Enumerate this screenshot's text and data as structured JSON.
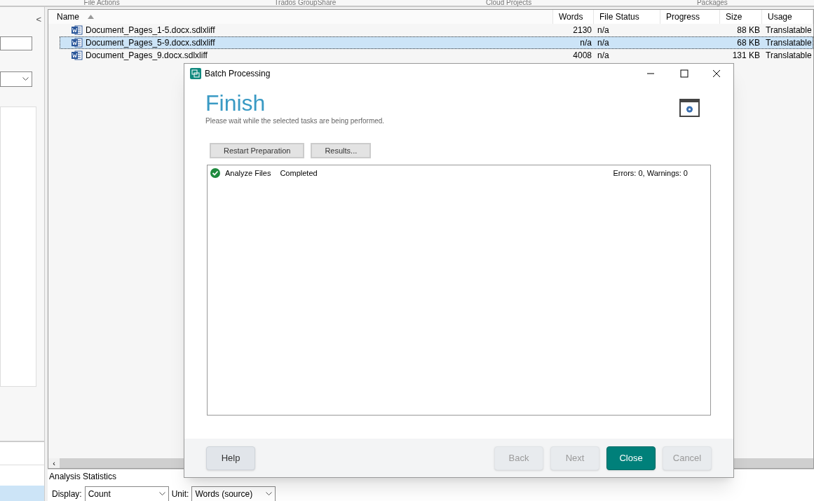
{
  "ribbon_groups": [
    "File Actions",
    "Trados GroupShare",
    "Cloud Projects",
    "Packages"
  ],
  "left_panel": {
    "collapse": "<"
  },
  "table": {
    "scroll_left": "‹",
    "columns": [
      {
        "label": "Name",
        "sorted": true
      },
      {
        "label": "Words",
        "sorted": false
      },
      {
        "label": "File Status",
        "sorted": false
      },
      {
        "label": "Progress",
        "sorted": false
      },
      {
        "label": "Size",
        "sorted": false
      },
      {
        "label": "Usage",
        "sorted": false
      }
    ],
    "rows": [
      {
        "name": "Document_Pages_1-5.docx.sdlxliff",
        "words": "2130",
        "file_status": "n/a",
        "size": "88 KB",
        "usage": "Translatable",
        "selected": false
      },
      {
        "name": "Document_Pages_5-9.docx.sdlxliff",
        "words": "n/a",
        "file_status": "n/a",
        "size": "68 KB",
        "usage": "Translatable",
        "selected": true
      },
      {
        "name": "Document_Pages_9.docx.sdlxliff",
        "words": "4008",
        "file_status": "n/a",
        "size": "131 KB",
        "usage": "Translatable",
        "selected": false
      }
    ]
  },
  "analysis": {
    "title": "Analysis Statistics",
    "display_label": "Display:",
    "display_value": "Count",
    "unit_label": "Unit:",
    "unit_value": "Words (source)"
  },
  "dialog": {
    "title": "Batch Processing",
    "heading": "Finish",
    "subtitle": "Please wait while the selected tasks are being performed.",
    "actions": [
      "Restart Preparation",
      "Results..."
    ],
    "tasks": [
      {
        "name": "Analyze Files",
        "status": "Completed",
        "summary": "Errors: 0, Warnings: 0",
        "done": true
      }
    ],
    "buttons": [
      {
        "label": "Help",
        "disabled": false,
        "primary": false
      },
      {
        "label": "Back",
        "disabled": true,
        "primary": false
      },
      {
        "label": "Next",
        "disabled": true,
        "primary": false
      },
      {
        "label": "Close",
        "disabled": false,
        "primary": true
      },
      {
        "label": "Cancel",
        "disabled": true,
        "primary": false
      }
    ]
  }
}
